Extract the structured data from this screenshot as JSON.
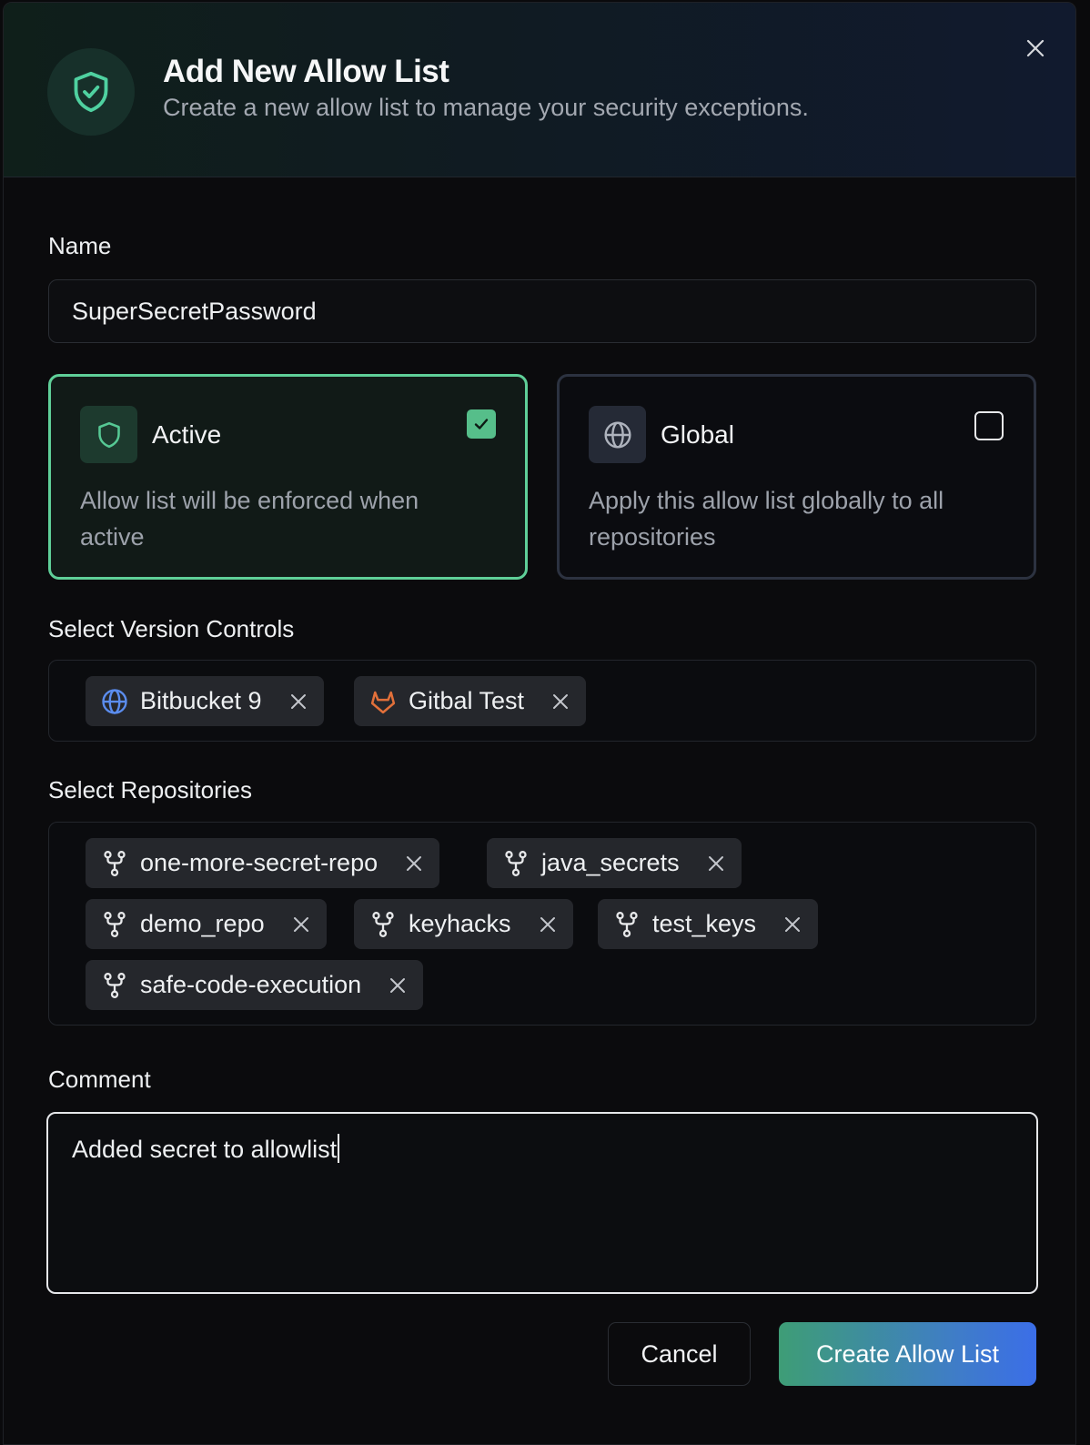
{
  "header": {
    "title": "Add New Allow List",
    "subtitle": "Create a new allow list to manage your security exceptions.",
    "icon": "shield-check-icon",
    "accent": "#4fd1a0"
  },
  "form": {
    "name_label": "Name",
    "name_value": "SuperSecretPassword",
    "options": {
      "active": {
        "title": "Active",
        "description": "Allow list will be enforced when active",
        "checked": true,
        "icon": "shield-icon"
      },
      "global": {
        "title": "Global",
        "description": "Apply this allow list globally to all repositories",
        "checked": false,
        "icon": "globe-icon"
      }
    },
    "version_controls_label": "Select Version Controls",
    "version_controls": [
      {
        "label": "Bitbucket 9",
        "icon": "globe-icon"
      },
      {
        "label": "Gitbal Test",
        "icon": "gitlab-icon"
      }
    ],
    "repositories_label": "Select Repositories",
    "repositories": [
      {
        "label": "one-more-secret-repo",
        "icon": "repo-fork-icon"
      },
      {
        "label": "java_secrets",
        "icon": "repo-fork-icon"
      },
      {
        "label": "demo_repo",
        "icon": "repo-fork-icon"
      },
      {
        "label": "keyhacks",
        "icon": "repo-fork-icon"
      },
      {
        "label": "test_keys",
        "icon": "repo-fork-icon"
      },
      {
        "label": "safe-code-execution",
        "icon": "repo-fork-icon"
      }
    ],
    "comment_label": "Comment",
    "comment_value": "Added secret to allowlist"
  },
  "footer": {
    "cancel_label": "Cancel",
    "create_label": "Create Allow List"
  },
  "colors": {
    "active_border": "#5fcf98",
    "primary_gradient_start": "#3e9d76",
    "primary_gradient_end": "#3b6ee8",
    "gitlab_orange": "#e2703a",
    "bitbucket_blue": "#5b8def"
  }
}
